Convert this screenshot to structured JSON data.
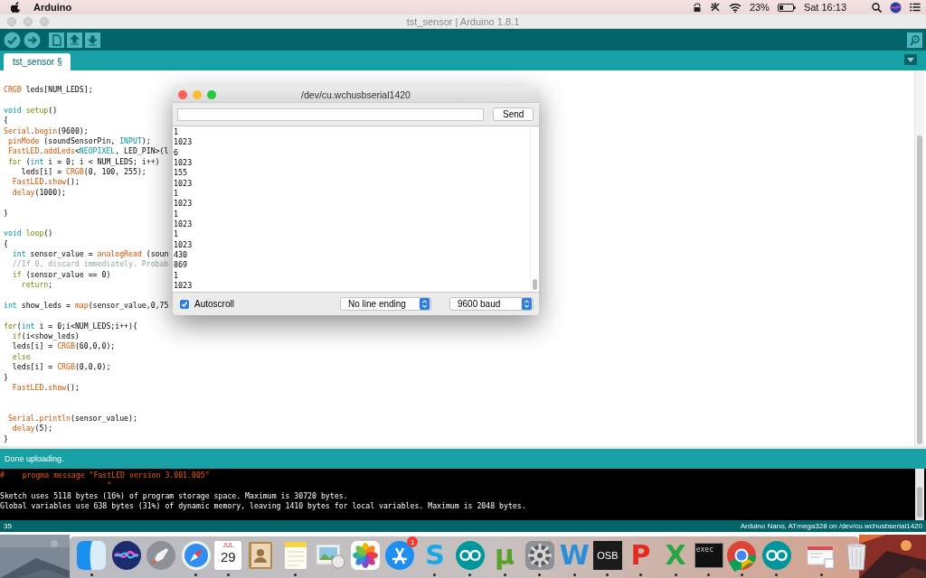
{
  "menubar": {
    "app": "Arduino",
    "battery": "23%",
    "clock": "Sat 16:13"
  },
  "window": {
    "title": "tst_sensor | Arduino 1.8.1"
  },
  "tabs": [
    {
      "label": "tst_sensor §",
      "selected": true
    }
  ],
  "editor": {
    "lines": [
      {
        "kind": "code",
        "segments": [
          {
            "text": "CRGB",
            "kind": "func"
          },
          {
            "text": " leds[NUM_LEDS];",
            "kind": "plain"
          }
        ]
      },
      {
        "kind": "blank"
      },
      {
        "kind": "code",
        "segments": [
          {
            "text": "void ",
            "kind": "type"
          },
          {
            "text": "setup",
            "kind": "keyword"
          },
          {
            "text": "()",
            "kind": "plain"
          }
        ]
      },
      {
        "kind": "code",
        "segments": [
          {
            "text": "{",
            "kind": "plain"
          }
        ]
      },
      {
        "kind": "code",
        "segments": [
          {
            "text": "Serial",
            "kind": "func"
          },
          {
            "text": ".",
            "kind": "plain"
          },
          {
            "text": "begin",
            "kind": "func"
          },
          {
            "text": "(9600);",
            "kind": "plain"
          }
        ]
      },
      {
        "kind": "code",
        "segments": [
          {
            "text": " pinMode",
            "kind": "func"
          },
          {
            "text": " (soundSensorPin, ",
            "kind": "plain"
          },
          {
            "text": "INPUT",
            "kind": "type"
          },
          {
            "text": ");",
            "kind": "plain"
          }
        ]
      },
      {
        "kind": "code",
        "segments": [
          {
            "text": " FastLED",
            "kind": "func"
          },
          {
            "text": ".",
            "kind": "plain"
          },
          {
            "text": "addLeds",
            "kind": "func"
          },
          {
            "text": "<",
            "kind": "plain"
          },
          {
            "text": "NEOPIXEL",
            "kind": "type"
          },
          {
            "text": ", LED_PIN>(l",
            "kind": "plain"
          }
        ]
      },
      {
        "kind": "code",
        "segments": [
          {
            "text": " for",
            "kind": "keyword"
          },
          {
            "text": " (",
            "kind": "plain"
          },
          {
            "text": "int",
            "kind": "type"
          },
          {
            "text": " i = 0; i < NUM_LEDS; i++)",
            "kind": "plain"
          }
        ]
      },
      {
        "kind": "code",
        "segments": [
          {
            "text": "    leds[i] = ",
            "kind": "plain"
          },
          {
            "text": "CRGB",
            "kind": "func"
          },
          {
            "text": "(0, 100, 255);",
            "kind": "plain"
          }
        ]
      },
      {
        "kind": "code",
        "segments": [
          {
            "text": "  FastLED",
            "kind": "func"
          },
          {
            "text": ".",
            "kind": "plain"
          },
          {
            "text": "show",
            "kind": "func"
          },
          {
            "text": "();",
            "kind": "plain"
          }
        ]
      },
      {
        "kind": "code",
        "segments": [
          {
            "text": "  delay",
            "kind": "func"
          },
          {
            "text": "(1000);",
            "kind": "plain"
          }
        ]
      },
      {
        "kind": "blank"
      },
      {
        "kind": "code",
        "segments": [
          {
            "text": "}",
            "kind": "plain"
          }
        ]
      },
      {
        "kind": "blank"
      },
      {
        "kind": "code",
        "segments": [
          {
            "text": "void ",
            "kind": "type"
          },
          {
            "text": "loop",
            "kind": "keyword"
          },
          {
            "text": "()",
            "kind": "plain"
          }
        ]
      },
      {
        "kind": "code",
        "segments": [
          {
            "text": "{",
            "kind": "plain"
          }
        ]
      },
      {
        "kind": "code",
        "segments": [
          {
            "text": "  int",
            "kind": "type"
          },
          {
            "text": " sensor_value = ",
            "kind": "plain"
          },
          {
            "text": "analogRead",
            "kind": "func"
          },
          {
            "text": " (soun",
            "kind": "plain"
          }
        ]
      },
      {
        "kind": "code",
        "segments": [
          {
            "text": "  //If 0, discard immediately. Probab",
            "kind": "comment"
          }
        ]
      },
      {
        "kind": "code",
        "segments": [
          {
            "text": "  if",
            "kind": "keyword"
          },
          {
            "text": " (sensor_value == 0)",
            "kind": "plain"
          }
        ]
      },
      {
        "kind": "code",
        "segments": [
          {
            "text": "    return",
            "kind": "keyword"
          },
          {
            "text": ";",
            "kind": "plain"
          }
        ]
      },
      {
        "kind": "blank"
      },
      {
        "kind": "code",
        "segments": [
          {
            "text": "int",
            "kind": "type"
          },
          {
            "text": " show_leds = ",
            "kind": "plain"
          },
          {
            "text": "map",
            "kind": "func"
          },
          {
            "text": "(sensor_value,0,75",
            "kind": "plain"
          }
        ]
      },
      {
        "kind": "blank"
      },
      {
        "kind": "code",
        "segments": [
          {
            "text": "for",
            "kind": "keyword"
          },
          {
            "text": "(",
            "kind": "plain"
          },
          {
            "text": "int",
            "kind": "type"
          },
          {
            "text": " i = 0;i<NUM_LEDS;i++){",
            "kind": "plain"
          }
        ]
      },
      {
        "kind": "code",
        "segments": [
          {
            "text": "  if",
            "kind": "keyword"
          },
          {
            "text": "(i<show_leds)",
            "kind": "plain"
          }
        ]
      },
      {
        "kind": "code",
        "segments": [
          {
            "text": "  leds[i] = ",
            "kind": "plain"
          },
          {
            "text": "CRGB",
            "kind": "func"
          },
          {
            "text": "(60,0,0);",
            "kind": "plain"
          }
        ]
      },
      {
        "kind": "code",
        "segments": [
          {
            "text": "  else",
            "kind": "keyword"
          }
        ]
      },
      {
        "kind": "code",
        "segments": [
          {
            "text": "  leds[i] = ",
            "kind": "plain"
          },
          {
            "text": "CRGB",
            "kind": "func"
          },
          {
            "text": "(0,0,0);",
            "kind": "plain"
          }
        ]
      },
      {
        "kind": "code",
        "segments": [
          {
            "text": "}",
            "kind": "plain"
          }
        ]
      },
      {
        "kind": "code",
        "segments": [
          {
            "text": "  FastLED",
            "kind": "func"
          },
          {
            "text": ".",
            "kind": "plain"
          },
          {
            "text": "show",
            "kind": "func"
          },
          {
            "text": "();",
            "kind": "plain"
          }
        ]
      },
      {
        "kind": "blank"
      },
      {
        "kind": "blank"
      },
      {
        "kind": "code",
        "segments": [
          {
            "text": " Serial",
            "kind": "func"
          },
          {
            "text": ".",
            "kind": "plain"
          },
          {
            "text": "println",
            "kind": "func"
          },
          {
            "text": "(sensor_value);",
            "kind": "plain"
          }
        ]
      },
      {
        "kind": "code",
        "segments": [
          {
            "text": "  delay",
            "kind": "func"
          },
          {
            "text": "(5);",
            "kind": "plain"
          }
        ]
      },
      {
        "kind": "code",
        "segments": [
          {
            "text": "}",
            "kind": "plain"
          }
        ]
      }
    ]
  },
  "serial_monitor": {
    "title": "/dev/cu.wchusbserial1420",
    "send_button": "Send",
    "output": [
      "1",
      "1023",
      "6",
      "1023",
      "155",
      "1023",
      "1",
      "1023",
      "1",
      "1023",
      "1",
      "1023",
      "430",
      "869",
      "1",
      "1023"
    ],
    "autoscroll": {
      "label": "Autoscroll",
      "checked": true
    },
    "line_ending": "No line ending",
    "baud": "9600 baud"
  },
  "status_message": "Done uploading.",
  "console": {
    "lines": [
      {
        "kind": "warning",
        "text": "#    progma message \"FastLED version 3.001.005\""
      },
      {
        "kind": "warning",
        "text": "                        ^"
      },
      {
        "kind": "info",
        "text": "Sketch uses 5118 bytes (16%) of program storage space. Maximum is 30720 bytes."
      },
      {
        "kind": "info",
        "text": "Global variables use 638 bytes (31%) of dynamic memory, leaving 1410 bytes for local variables. Maximum is 2048 bytes."
      }
    ]
  },
  "status_bar": {
    "line": "35",
    "board": "Arduino Nano, ATmega328 on /dev/cu.wchusbserial1420"
  },
  "dock": {
    "items": [
      {
        "kind": "finder",
        "running": true
      },
      {
        "kind": "siri"
      },
      {
        "kind": "launchpad"
      },
      {
        "kind": "safari",
        "running": true
      },
      {
        "kind": "calendar",
        "running": true,
        "month": "JUL",
        "day": "29"
      },
      {
        "kind": "contacts"
      },
      {
        "kind": "notes",
        "running": true
      },
      {
        "kind": "preview"
      },
      {
        "kind": "photos"
      },
      {
        "kind": "appstore",
        "badge": "1"
      },
      {
        "kind": "glyph",
        "running": true,
        "glyph": "S",
        "color": "#1aa7e8"
      },
      {
        "kind": "arduino",
        "running": true
      },
      {
        "kind": "glyph",
        "running": true,
        "glyph": "µ",
        "color": "#5aa02c"
      },
      {
        "kind": "settings",
        "running": true
      },
      {
        "kind": "glyph",
        "running": true,
        "glyph": "W",
        "color": "#2a8fd8"
      },
      {
        "kind": "label",
        "running": true,
        "glyph": "OSB",
        "color": "#1a1a1a"
      },
      {
        "kind": "glyph",
        "running": true,
        "glyph": "P",
        "color": "#e32b1f"
      },
      {
        "kind": "glyph",
        "running": true,
        "glyph": "X",
        "color": "#27a844"
      },
      {
        "kind": "terminal",
        "running": true,
        "glyph": "exec"
      },
      {
        "kind": "chrome",
        "running": true
      },
      {
        "kind": "arduino",
        "running": true
      },
      {
        "kind": "separator"
      },
      {
        "kind": "document",
        "running": true
      },
      {
        "kind": "trash"
      }
    ]
  }
}
